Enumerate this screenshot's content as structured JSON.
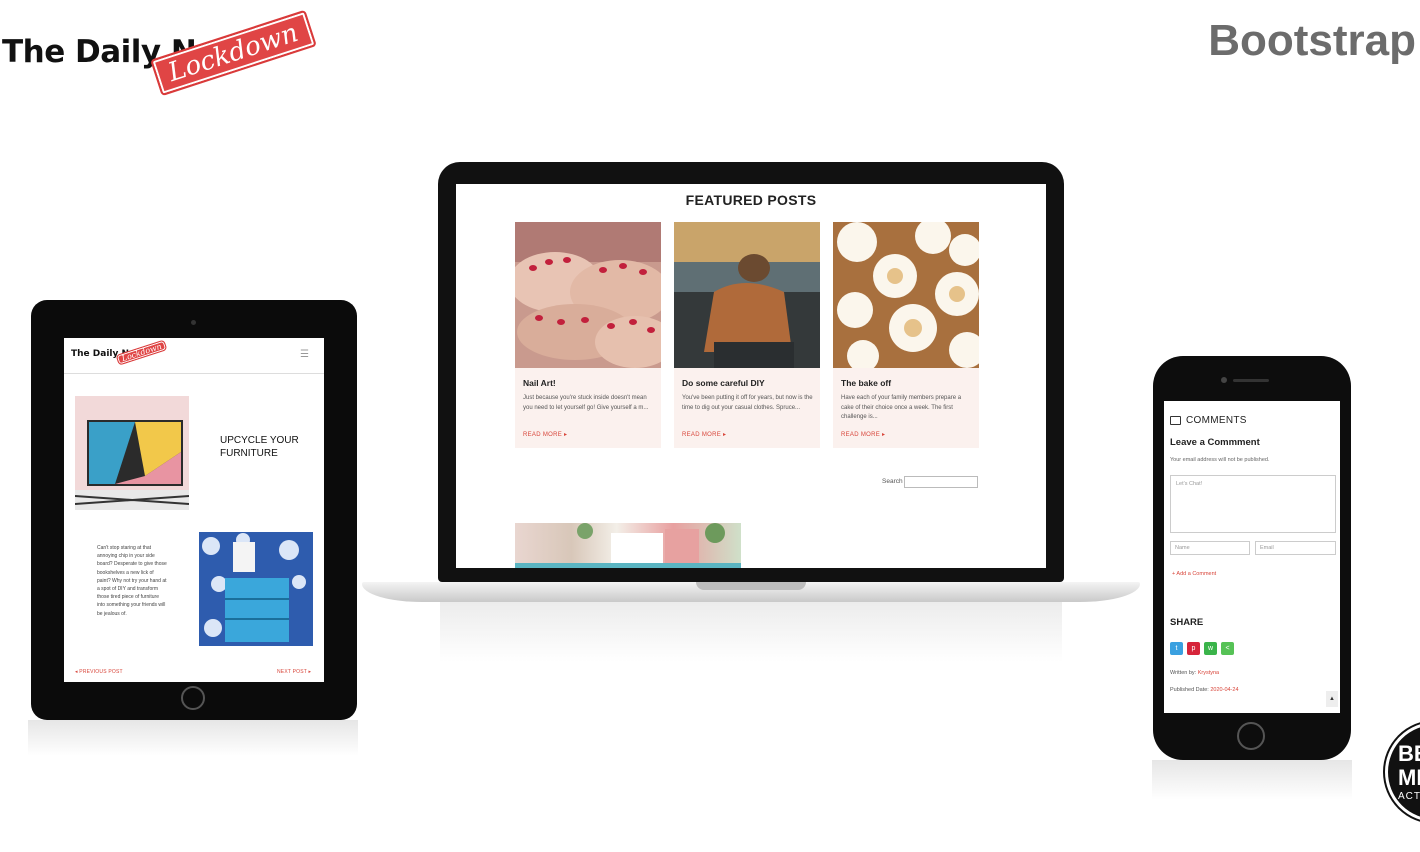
{
  "header": {
    "logo_text": "The Daily News",
    "logo_stamp": "Lockdown",
    "headline": "Bootstrap"
  },
  "badge": {
    "line1": "BE",
    "line2": "MI",
    "line3": "ACT"
  },
  "laptop": {
    "section_title": "FEATURED POSTS",
    "posts": [
      {
        "title": "Nail Art!",
        "excerpt": "Just because you're stuck inside doesn't mean you need to let yourself go! Give yourself a m...",
        "read_more": "READ MORE ▸"
      },
      {
        "title": "Do some careful DIY",
        "excerpt": "You've been putting it off for years, but now is the time to dig out your casual clothes. Spruce...",
        "read_more": "READ MORE ▸"
      },
      {
        "title": "The bake off",
        "excerpt": "Have each of your family members prepare a cake of their choice once a week. The first challenge is...",
        "read_more": "READ MORE ▸"
      }
    ],
    "search_label": "Search"
  },
  "tablet": {
    "logo_text": "The Daily News",
    "logo_stamp": "Lockdown",
    "menu_icon": "☰",
    "feature_title": "UPCYCLE YOUR FURNITURE",
    "feature_text": "Can't stop staring at that annoying chip in your side board? Desperate to give those bookshelves a new lick of paint? Why not try your hand at a spot of DIY and transform those tired piece of furniture into something your friends will be jealous of.",
    "prev": "◂ PREVIOUS POST",
    "next": "NEXT POST ▸"
  },
  "phone": {
    "comments_title": "COMMENTS",
    "leave_comment": "Leave a Commment",
    "email_note": "Your email address will not be published.",
    "textarea_placeholder": "Let's Chat!",
    "name_placeholder": "Name",
    "email_placeholder": "Email",
    "add_comment": "+ Add a Comment",
    "share_title": "SHARE",
    "written_label": "Written by:",
    "author": "Krystyna",
    "published_label": "Published Date:",
    "published_date": "2020-04-24",
    "back_to_top": "▲"
  },
  "colors": {
    "accent": "#d8453a",
    "card_bg": "#fbf1ee",
    "headline": "#6c6c6c",
    "twitter": "#3aa0e0",
    "pinterest": "#d6243a",
    "whatsapp": "#3ab44a",
    "share": "#56c256"
  }
}
